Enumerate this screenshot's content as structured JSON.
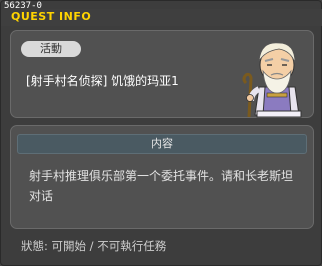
{
  "window": {
    "id_tag": "56237-0",
    "title": "QUEST INFO"
  },
  "quest": {
    "category_tag": "活動",
    "name": "[射手村名侦探] 饥饿的玛亚1",
    "npc": "elder-npc-portrait"
  },
  "details": {
    "section_header": "内容",
    "description": "射手村推理俱乐部第一个委托事件。请和长老斯坦对话"
  },
  "footer": {
    "status": "狀態:  可開始 / 不可執行任務"
  },
  "colors": {
    "title": "#ffd400",
    "window_bg": "#3d3d3d",
    "panel_bg": "#515151",
    "header_bg": "#4a5a62"
  }
}
